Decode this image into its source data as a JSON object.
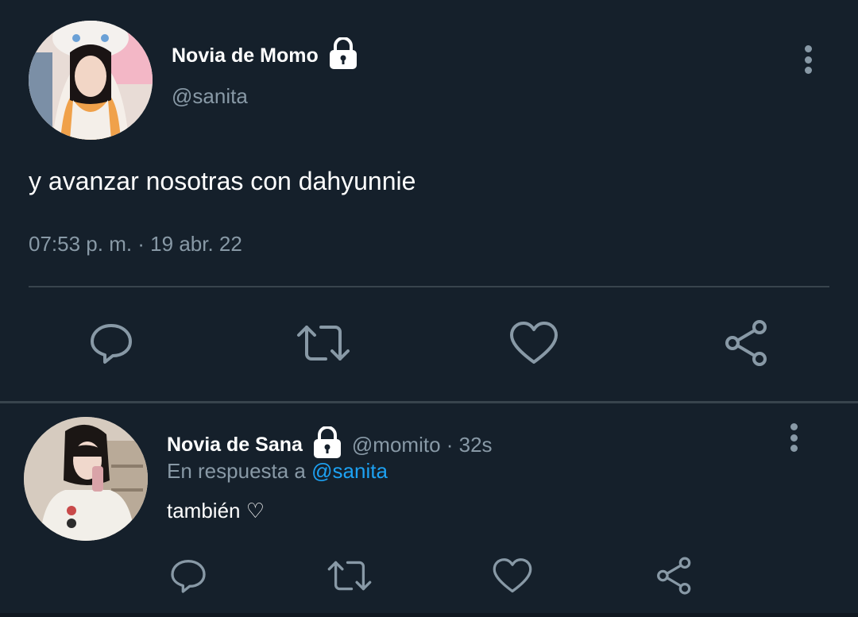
{
  "main_tweet": {
    "display_name": "Novia de Momo",
    "handle": "@sanita",
    "text": "y avanzar nosotras con dahyunnie",
    "timestamp": "07:53 p. m. · 19 abr. 22",
    "actions": [
      "reply-icon",
      "retweet-icon",
      "like-icon",
      "share-icon"
    ]
  },
  "reply_tweet": {
    "display_name": "Novia de Sana",
    "handle_time": "@momito · 32s",
    "reply_prefix": "En respuesta a",
    "reply_mention": "@sanita",
    "text": "también ♡",
    "actions": [
      "reply-icon",
      "retweet-icon",
      "like-icon",
      "share-icon"
    ]
  },
  "colors": {
    "background": "#15202b",
    "secondary_text": "#8899a6",
    "divider": "#38444d",
    "link": "#1da1f2"
  }
}
